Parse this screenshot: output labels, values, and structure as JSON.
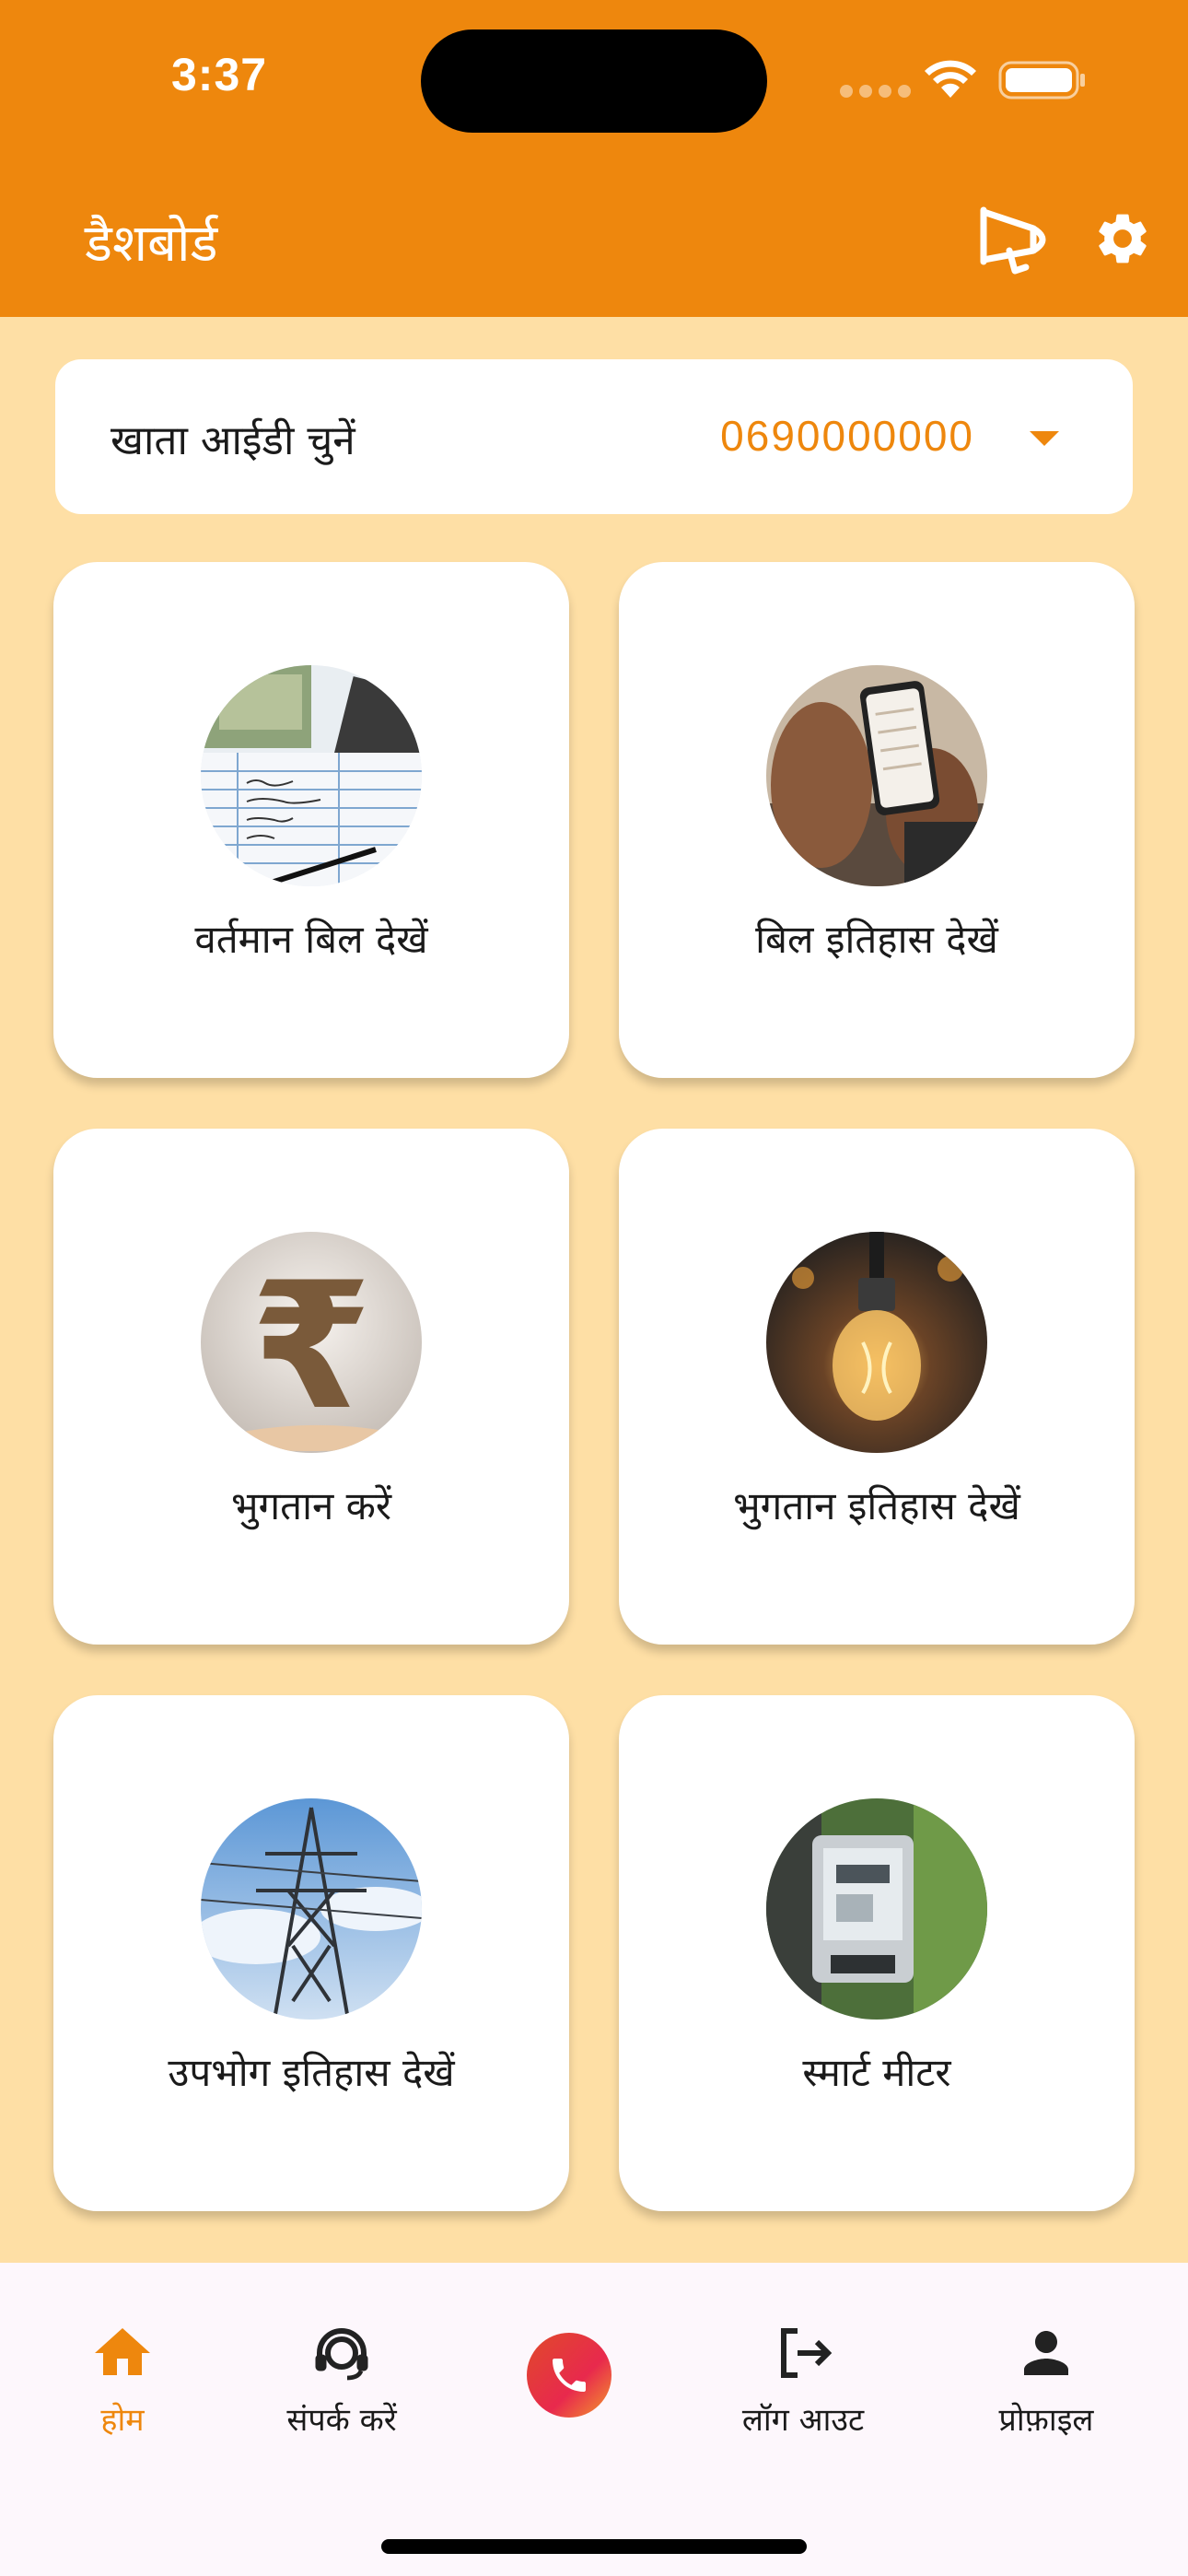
{
  "status_bar": {
    "time": "3:37"
  },
  "header": {
    "title": "डैशबोर्ड",
    "icons": [
      "megaphone-icon",
      "gear-icon"
    ]
  },
  "account": {
    "label": "खाता आईडी चुनें",
    "value": "0690000000"
  },
  "tiles": [
    {
      "label": "वर्तमान बिल देखें",
      "image": "bill-document-photo"
    },
    {
      "label": "बिल इतिहास देखें",
      "image": "phone-in-hands-photo"
    },
    {
      "label": "भुगतान करें",
      "image": "rupee-symbol-photo"
    },
    {
      "label": "भुगतान इतिहास देखें",
      "image": "light-bulb-photo"
    },
    {
      "label": "उपभोग इतिहास देखें",
      "image": "transmission-tower-photo"
    },
    {
      "label": "स्मार्ट मीटर",
      "image": "electric-meter-photo"
    }
  ],
  "bottom_nav": {
    "items": [
      {
        "label": "होम",
        "icon": "home-icon",
        "active": true
      },
      {
        "label": "संपर्क करें",
        "icon": "headset-icon"
      },
      {
        "label": "",
        "icon": "phone-icon"
      },
      {
        "label": "लॉग आउट",
        "icon": "logout-icon"
      },
      {
        "label": "प्रोफ़ाइल",
        "icon": "person-icon"
      }
    ]
  },
  "colors": {
    "accent": "#EE870D",
    "background": "#FEDFA5",
    "card": "#FFFFFF",
    "nav_background": "#FDF7FC"
  }
}
